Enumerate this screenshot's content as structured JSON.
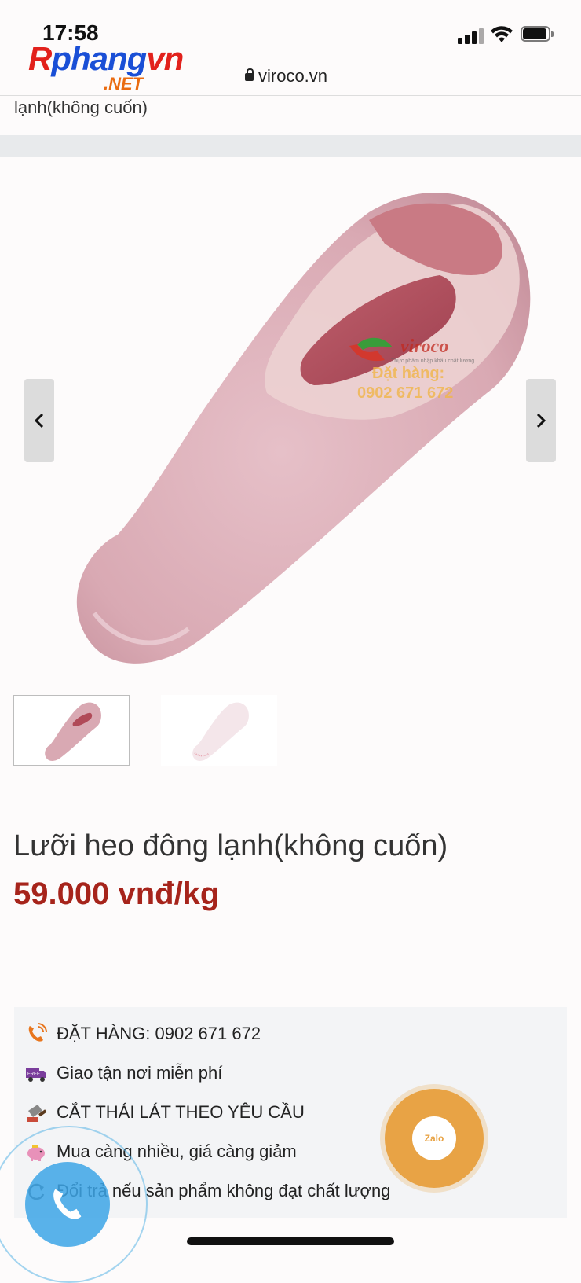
{
  "status_bar": {
    "time": "17:58"
  },
  "browser": {
    "url": "viroco.vn"
  },
  "watermark": {
    "name_r": "R",
    "name_phang": "phang",
    "name_vn": "vn",
    "suffix": ".NET"
  },
  "breadcrumb": {
    "text": "lạnh(không cuốn)"
  },
  "image": {
    "brand": "viroco",
    "tagline": "Thực phẩm nhập khẩu chất lượng",
    "order_label": "Đặt hàng:",
    "phone": "0902 671 672"
  },
  "product": {
    "title": "Lưỡi heo đông lạnh(không cuốn)",
    "price": "59.000 vnđ/kg"
  },
  "benefits": [
    {
      "icon": "phone-call-icon",
      "text": "ĐẶT HÀNG: 0902 671 672"
    },
    {
      "icon": "free-delivery-truck-icon",
      "text": "Giao tận nơi miễn phí"
    },
    {
      "icon": "cleaver-icon",
      "text": "CẮT THÁI LÁT THEO YÊU CẦU"
    },
    {
      "icon": "piggy-bank-icon",
      "text": "Mua càng nhiều, giá càng giảm"
    },
    {
      "icon": "return-arrow-icon",
      "text": "Đổi trả nếu sản phẩm không đạt chất lượng"
    }
  ],
  "zalo": {
    "label": "Zalo"
  },
  "colors": {
    "price": "#a6241b",
    "zalo": "#e8a345",
    "call": "#3ca4e6",
    "watermark_text": "#f0b64a"
  }
}
